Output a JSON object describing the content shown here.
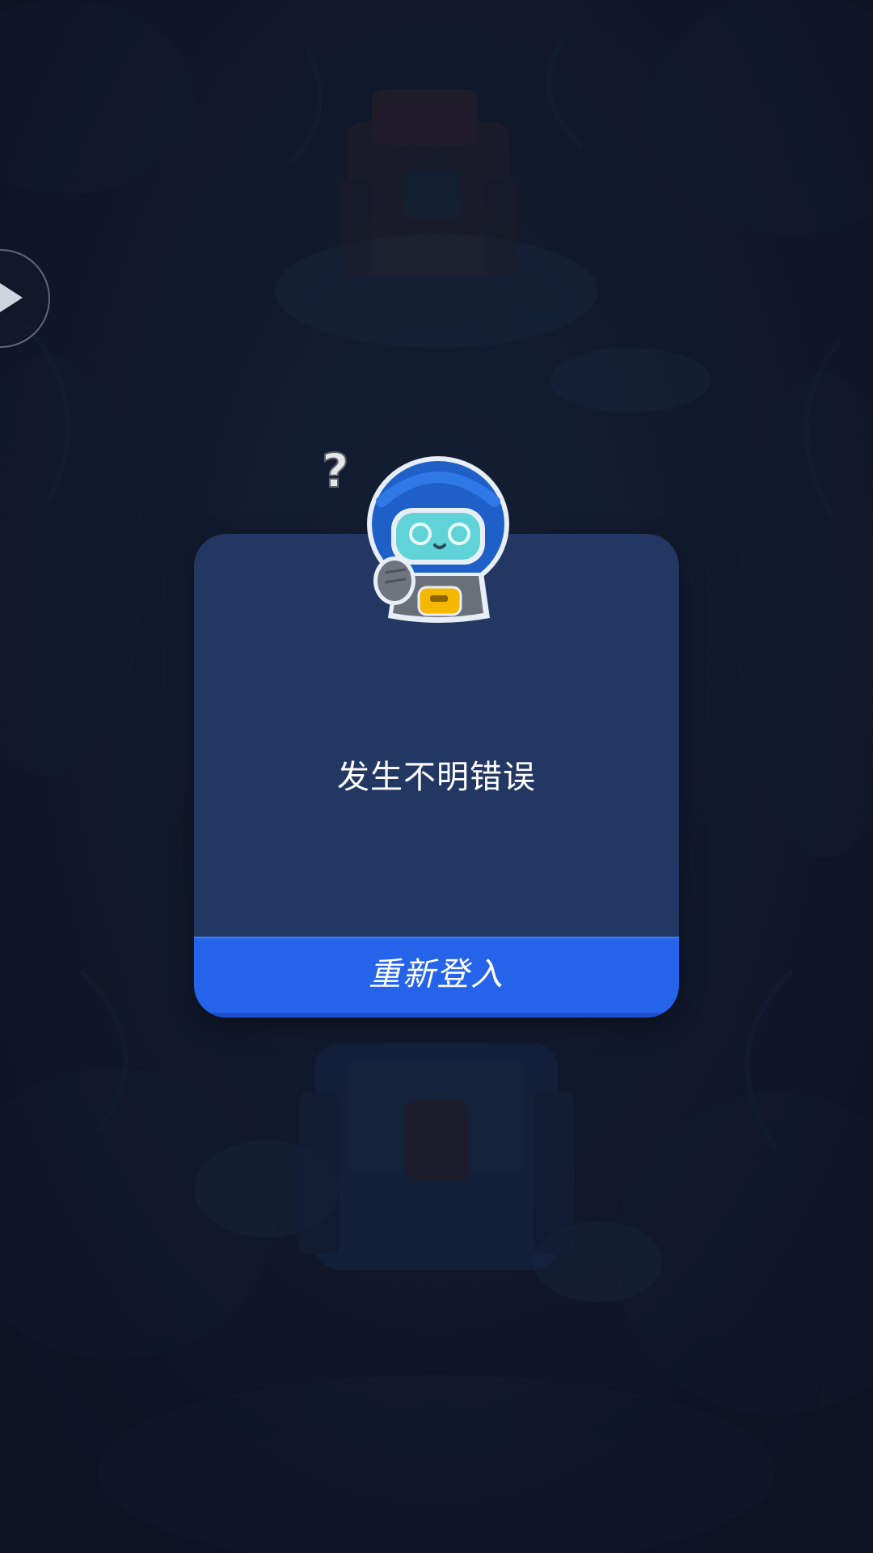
{
  "dialog": {
    "message": "发生不明错误",
    "button_label": "重新登入"
  },
  "colors": {
    "dialog_bg": "#233763",
    "button_bg": "#2563eb",
    "screen_bg": "#131c31"
  },
  "icons": {
    "side_button": "play-triangle-icon",
    "mascot": "confused-robot-mascot-icon",
    "question": "question-mark-icon"
  }
}
